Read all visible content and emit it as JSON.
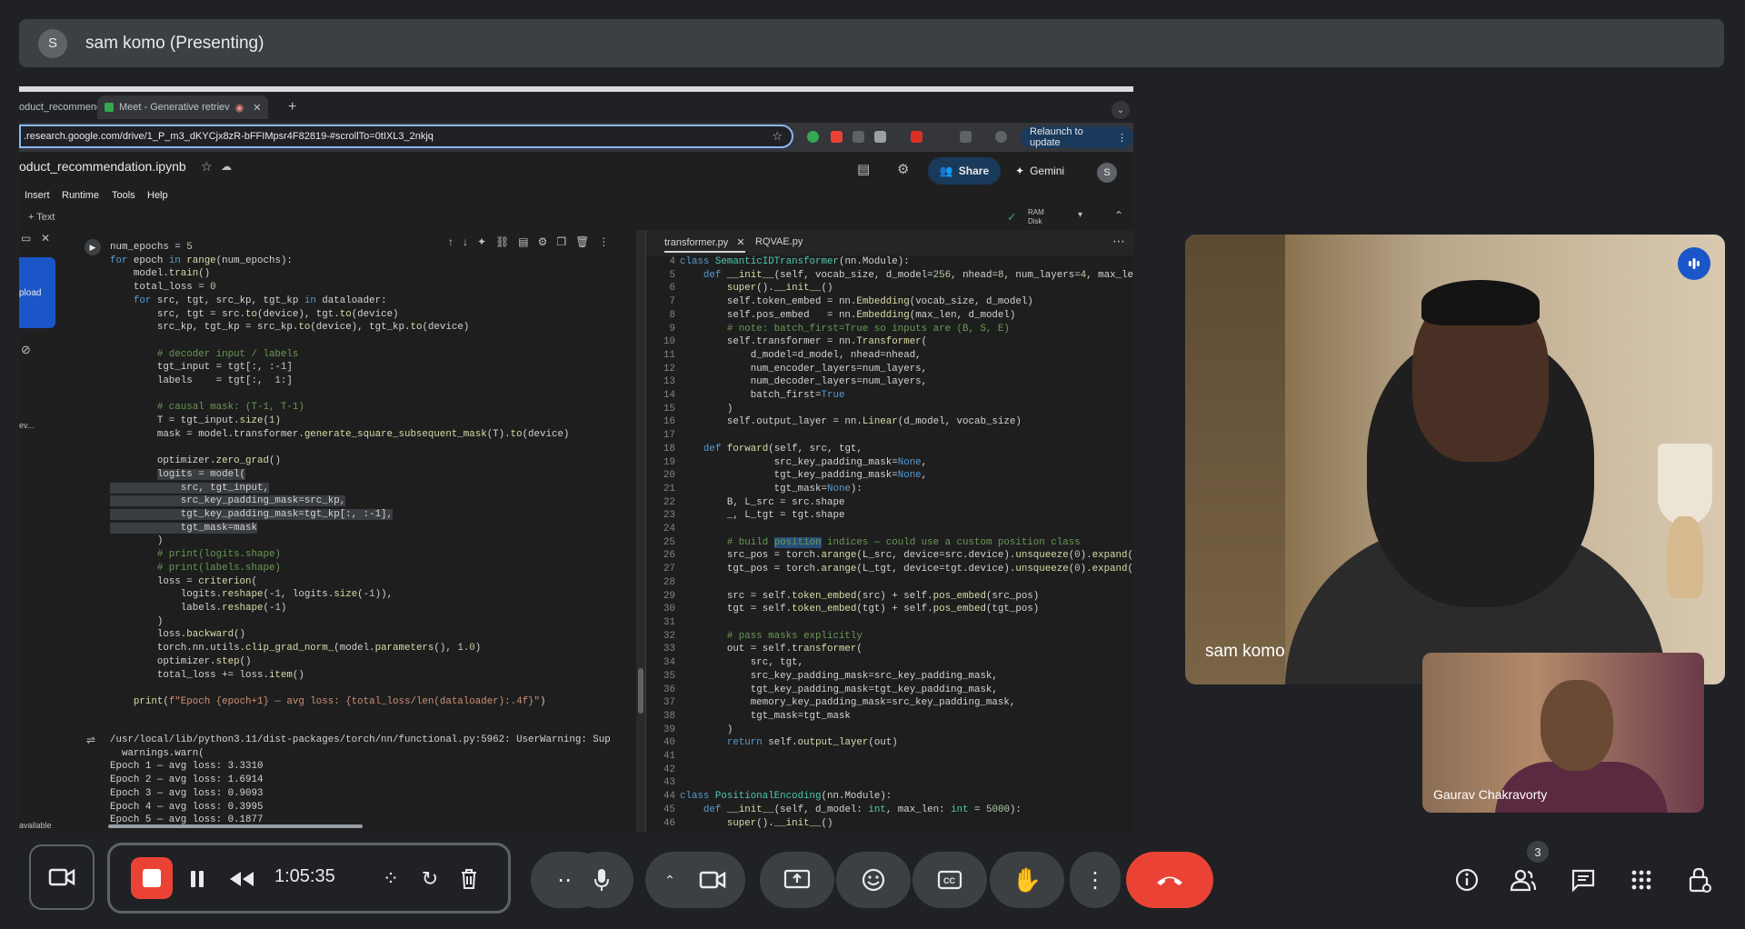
{
  "presenter": {
    "avatar_initial": "S",
    "title": "sam komo (Presenting)"
  },
  "browser": {
    "tabs": [
      {
        "label": "oduct_recommend"
      },
      {
        "label": "Meet - Generative retriev"
      }
    ],
    "url": ".research.google.com/drive/1_P_m3_dKYCjx8zR-bFFIMpsr4F82819-#scrollTo=0tIXL3_2nkjq",
    "relaunch_label": "Relaunch to update",
    "profile_initial": "S"
  },
  "colab": {
    "notebook_title": "oduct_recommendation.ipynb",
    "menu": [
      "Insert",
      "Runtime",
      "Tools",
      "Help"
    ],
    "share_label": "Share",
    "gemini_label": "Gemini",
    "avatar_initial": "S",
    "add_text_label": "+ Text",
    "ram_label": "RAM",
    "disk_label": "Disk",
    "sidebar_upload": "pload",
    "sidebar_item": "ev...",
    "sidebar_available": "available"
  },
  "editor": {
    "tabs": [
      "transformer.py",
      "RQVAE.py"
    ]
  },
  "videos": {
    "main_name": "sam komo",
    "small_name": "Gaurav Chakravorty"
  },
  "controls": {
    "timer": "1:05:35",
    "participants_count": "3"
  },
  "colors": {
    "accent": "#1a56c8",
    "record": "#ea4335",
    "bar": "#3c4043"
  }
}
